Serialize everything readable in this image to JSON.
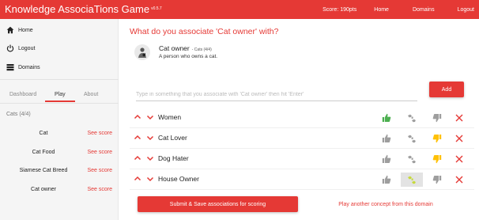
{
  "app": {
    "title": "Knowledge AssociaTions Game",
    "version": "v0.5.7"
  },
  "topnav": {
    "score": "Score: 190pts",
    "home": "Home",
    "domains": "Domains",
    "logout": "Logout"
  },
  "sidebar": {
    "items": [
      {
        "label": "Home",
        "icon": "home-icon"
      },
      {
        "label": "Logout",
        "icon": "power-icon"
      },
      {
        "label": "Domains",
        "icon": "domains-icon"
      }
    ],
    "tabs": [
      {
        "label": "Dashboard",
        "active": false
      },
      {
        "label": "Play",
        "active": true
      },
      {
        "label": "About",
        "active": false
      }
    ],
    "domain_label": "Cats (4/4)",
    "concepts": [
      {
        "name": "Cat",
        "see_score": "See score"
      },
      {
        "name": "Cat Food",
        "see_score": "See score"
      },
      {
        "name": "Siamese Cat Breed",
        "see_score": "See score"
      },
      {
        "name": "Cat owner",
        "see_score": "See score"
      }
    ]
  },
  "main": {
    "question": "What do you associate 'Cat owner' with?",
    "concept": {
      "title": "Cat owner",
      "subtitle": "- Cats (4/4)",
      "description": "A person who owns a cat."
    },
    "input_placeholder": "Type in something that you associate with 'Cat owner' then hit 'Enter'",
    "add_label": "Add",
    "associations": [
      {
        "label": "Women",
        "vote": "up"
      },
      {
        "label": "Cat Lover",
        "vote": "down"
      },
      {
        "label": "Dog Hater",
        "vote": "down"
      },
      {
        "label": "House Owner",
        "vote": "mid"
      }
    ],
    "submit_label": "Submit & Save associations for scoring",
    "another_label": "Play another concept from this domain"
  },
  "colors": {
    "accent": "#e53935",
    "vote_up": "#4caf50",
    "vote_mid": "#c6d93a",
    "vote_down": "#ffc107",
    "vote_idle": "#9e9e9e"
  }
}
